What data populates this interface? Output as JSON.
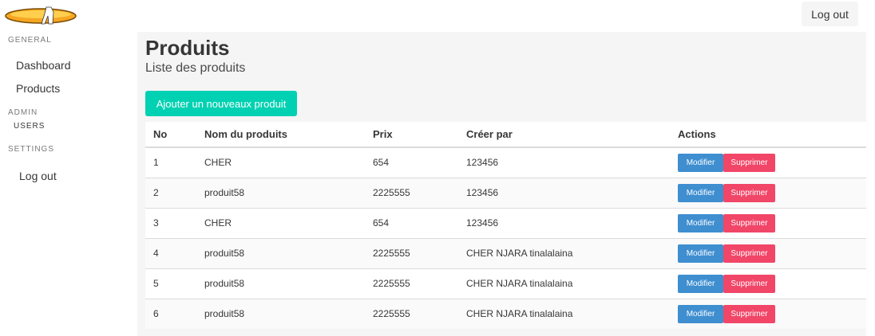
{
  "header": {
    "logout_label": "Log out"
  },
  "sidebar": {
    "general_label": "General",
    "general_items": [
      "Dashboard",
      "Products"
    ],
    "admin_label": "Admin",
    "admin_items": [
      "Users"
    ],
    "settings_label": "Settings",
    "settings_items": [
      "Log out"
    ]
  },
  "main": {
    "title": "Produits",
    "subtitle": "Liste des produits",
    "add_button_label": "Ajouter un nouveaux produit",
    "table": {
      "headers": [
        "No",
        "Nom du produits",
        "Prix",
        "Créer par",
        "Actions"
      ],
      "edit_label": "Modifier",
      "delete_label": "Supprimer",
      "rows": [
        [
          "1",
          "CHER",
          "654",
          "123456"
        ],
        [
          "2",
          "produit58",
          "2225555",
          "123456"
        ],
        [
          "3",
          "CHER",
          "654",
          "123456"
        ],
        [
          "4",
          "produit58",
          "2225555",
          "CHER NJARA tinalalaina"
        ],
        [
          "5",
          "produit58",
          "2225555",
          "CHER NJARA tinalalaina"
        ],
        [
          "6",
          "produit58",
          "2225555",
          "CHER NJARA tinalalaina"
        ]
      ]
    }
  },
  "colors": {
    "primary": "#00d1b2",
    "info": "#3e8ed0",
    "danger": "#f14668",
    "background": "#f5f5f5"
  }
}
